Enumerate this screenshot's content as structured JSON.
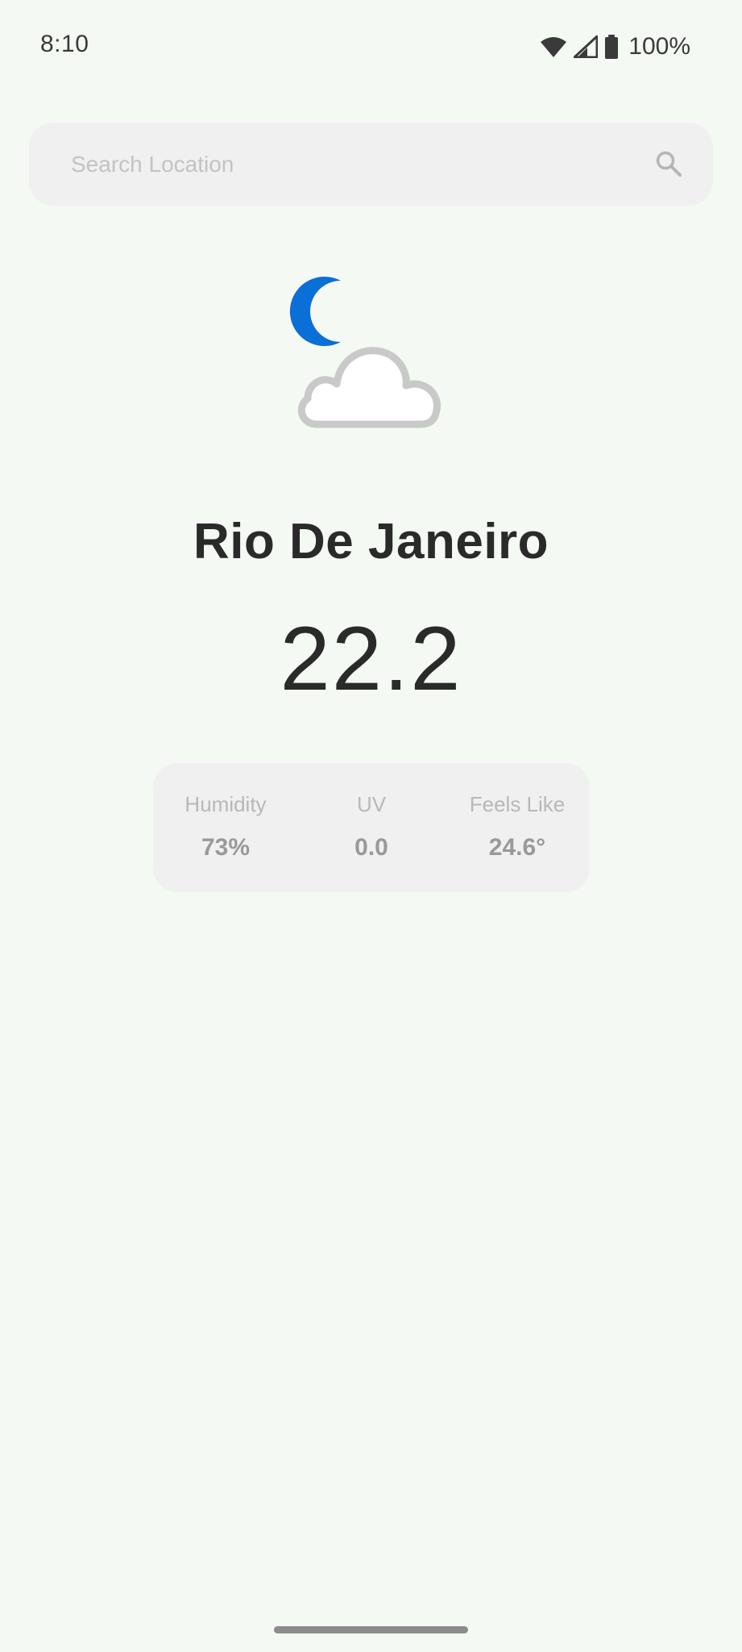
{
  "status_bar": {
    "time": "8:10",
    "battery_text": "100%",
    "icons": [
      "wifi-icon",
      "signal-icon",
      "battery-icon"
    ]
  },
  "search": {
    "placeholder": "Search Location",
    "value": "",
    "icon": "search-icon"
  },
  "weather": {
    "icon": "night-cloudy-icon",
    "city": "Rio De Janeiro",
    "temperature": "22.2"
  },
  "stats": {
    "humidity": {
      "label": "Humidity",
      "value": "73%"
    },
    "uv": {
      "label": "UV",
      "value": "0.0"
    },
    "feels_like": {
      "label": "Feels Like",
      "value": "24.6°"
    }
  },
  "colors": {
    "background": "#f5f9f3",
    "card": "#f0f0f0",
    "moon": "#0a6fd6",
    "text_primary": "#2a2a2a",
    "text_muted": "#b8b8b8"
  }
}
